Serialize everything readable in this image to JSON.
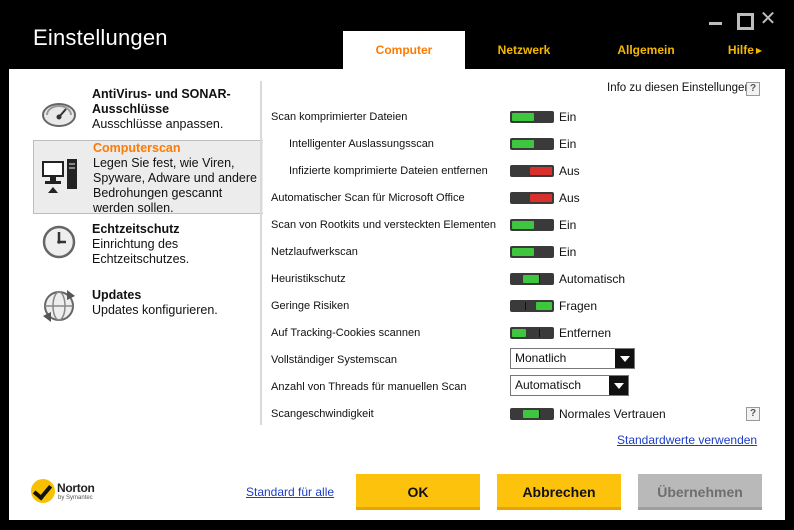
{
  "window": {
    "title": "Einstellungen"
  },
  "tabs": [
    {
      "label": "Computer",
      "active": true
    },
    {
      "label": "Netzwerk",
      "active": false
    },
    {
      "label": "Allgemein",
      "active": false
    },
    {
      "label": "Hilfe",
      "active": false
    }
  ],
  "sidebar": {
    "items": [
      {
        "title": "AntiVirus- und SONAR-Ausschlüsse",
        "desc": "Ausschlüsse anpassen.",
        "icon": "gauge-icon",
        "active": false
      },
      {
        "title": "Computerscan",
        "desc": "Legen Sie fest, wie Viren, Spyware, Adware und andere Bedrohungen gescannt werden sollen.",
        "icon": "computer-icon",
        "active": true
      },
      {
        "title": "Echtzeitschutz",
        "desc": "Einrichtung des Echtzeitschutzes.",
        "icon": "clock-icon",
        "active": false
      },
      {
        "title": "Updates",
        "desc": "Updates konfigurieren.",
        "icon": "globe-update-icon",
        "active": false
      }
    ]
  },
  "settings": {
    "info_label": "Info zu diesen Einstellungen",
    "help_glyph": "?",
    "rows": [
      {
        "label": "Scan komprimierter Dateien",
        "value": "Ein",
        "control": "toggle",
        "state": "on"
      },
      {
        "label": "Intelligenter Auslassungsscan",
        "value": "Ein",
        "control": "toggle",
        "state": "on"
      },
      {
        "label": "Infizierte komprimierte Dateien entfernen",
        "value": "Aus",
        "control": "toggle",
        "state": "off"
      },
      {
        "label": "Automatischer Scan für Microsoft Office",
        "value": "Aus",
        "control": "toggle",
        "state": "off"
      },
      {
        "label": "Scan von Rootkits und versteckten Elementen",
        "value": "Ein",
        "control": "toggle",
        "state": "on"
      },
      {
        "label": "Netzlaufwerkscan",
        "value": "Ein",
        "control": "toggle",
        "state": "on"
      },
      {
        "label": "Heuristikschutz",
        "value": "Automatisch",
        "control": "toggle",
        "state": "mid"
      },
      {
        "label": "Geringe Risiken",
        "value": "Fragen",
        "control": "toggle",
        "state": "mid2"
      },
      {
        "label": "Auf Tracking-Cookies scannen",
        "value": "Entfernen",
        "control": "toggle",
        "state": "low"
      },
      {
        "label": "Vollständiger Systemscan",
        "value": "Monatlich",
        "control": "select"
      },
      {
        "label": "Anzahl von Threads für manuellen Scan",
        "value": "Automatisch",
        "control": "select"
      },
      {
        "label": "Scangeschwindigkeit",
        "value": "Normales Vertrauen",
        "control": "toggle",
        "state": "mid"
      }
    ],
    "defaults_link": "Standardwerte verwenden"
  },
  "footer": {
    "brand": "Norton",
    "brand_sub": "by Symantec",
    "std_all_link": "Standard für alle",
    "ok_label": "OK",
    "cancel_label": "Abbrechen",
    "apply_label": "Übernehmen"
  },
  "colors": {
    "accent_orange": "#ff7a00",
    "tab_yellow": "#f5b800",
    "button_yellow": "#fdc20b",
    "toggle_green": "#3ec73e",
    "toggle_red": "#d8302a"
  }
}
